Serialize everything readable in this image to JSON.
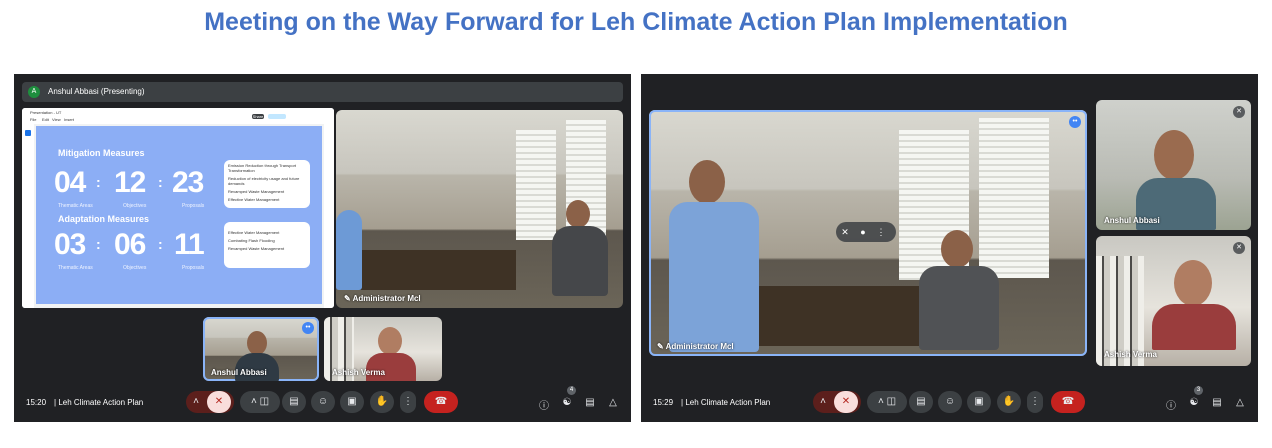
{
  "title": "Meeting on the Way Forward for Leh Climate Action Plan Implementation",
  "colors": {
    "title": "#4472c4",
    "meet_background": "#202124",
    "control_button": "#3c4043",
    "end_call": "#c5221f",
    "speaking_highlight": "#8ab4f8",
    "slide_background": "#8caef5"
  },
  "icons": {
    "mic_off": "mic-off-icon",
    "camera": "camera-icon",
    "captions": "captions-icon",
    "emoji": "emoji-icon",
    "present": "present-icon",
    "hand": "raise-hand-icon",
    "more": "more-options-icon",
    "end_call": "end-call-icon",
    "info": "info-icon",
    "people": "people-icon",
    "chat": "chat-icon",
    "activities": "activities-icon"
  },
  "left": {
    "presenter_initial": "A",
    "presenter_label": "Anshul Abbasi (Presenting)",
    "slide": {
      "mitigation_heading": "Mitigation Measures",
      "mitigation_numbers": [
        "04",
        "12",
        "23"
      ],
      "number_captions": [
        "Thematic Areas",
        "Objectives",
        "Proposals"
      ],
      "mitigation_items": [
        "Emission Reduction through Transport Transformation",
        "Reduction of electricity usage and future demands",
        "Revamped Waste Management",
        "Effective Water Management"
      ],
      "adaptation_heading": "Adaptation Measures",
      "adaptation_numbers": [
        "03",
        "06",
        "11"
      ],
      "adaptation_items": [
        "Effective Water Management",
        "Combating Flash Flooding",
        "Revamped Waste Management"
      ],
      "menu": [
        "Presentation - UT",
        "File",
        "Edit",
        "View",
        "Insert",
        "Format",
        "Slide"
      ],
      "share_label": "Share"
    },
    "main_tile_name": "Administrator Mcl",
    "participants": [
      {
        "name": "Anshul Abbasi",
        "speaking": true
      },
      {
        "name": "Ashish Verma",
        "speaking": false
      }
    ],
    "clock": "15:20",
    "meeting_name": "Leh Climate Action Plan",
    "people_count": "4"
  },
  "right": {
    "main_tile_name": "Administrator Mcl",
    "participants": [
      {
        "name": "Anshul Abbasi"
      },
      {
        "name": "Ashish Verma"
      }
    ],
    "clock": "15:29",
    "meeting_name": "Leh Climate Action Plan",
    "people_count": "3"
  }
}
